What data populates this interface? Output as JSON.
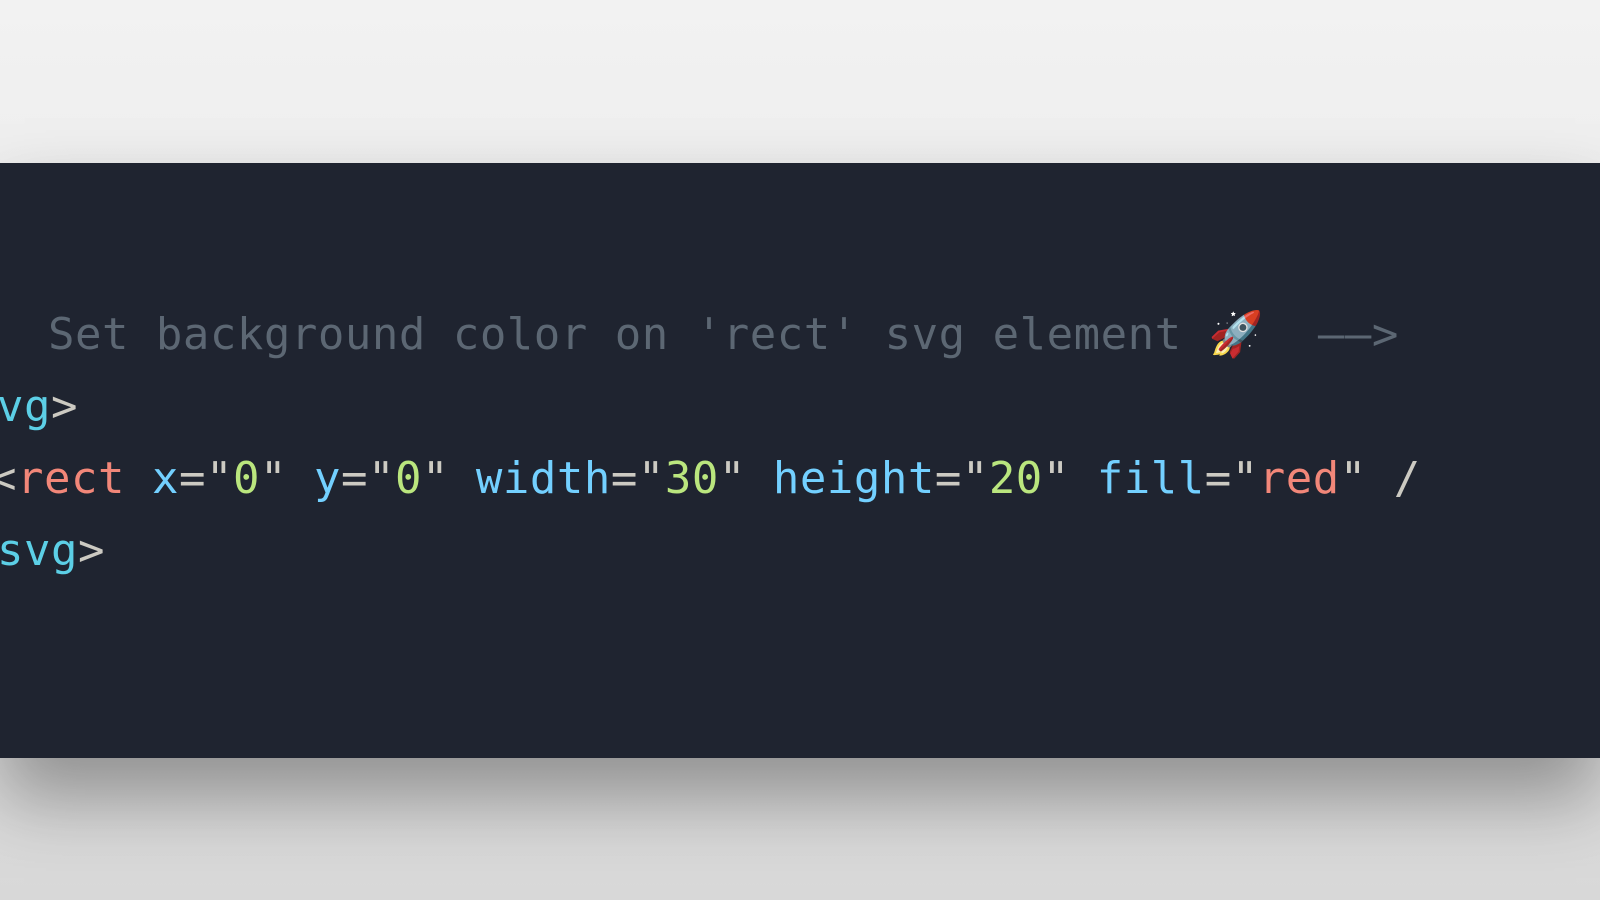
{
  "code": {
    "comment_open_dashes": "—— ",
    "comment_text": " Set background color on 'rect' svg element ",
    "comment_emoji": "🚀",
    "comment_close_arrow": "  ——>",
    "open_svg_text": "svg",
    "open_svg_brkt": ">",
    "rect_open": "<",
    "rect_tag": "rect",
    "attr_x": " x",
    "eq1": "=",
    "val_x_q": "\"",
    "val_x": "0",
    "attr_y": " y",
    "eq2": "=",
    "val_y": "0",
    "attr_width": " width",
    "eq3": "=",
    "val_width": "30",
    "attr_height": " height",
    "eq4": "=",
    "val_height": "20",
    "attr_fill": " fill",
    "eq5": "=",
    "val_fill": "red",
    "val_q": "\"",
    "rect_trailing": " /",
    "close_svg_slash": "/",
    "close_svg_text": "svg",
    "close_svg_brkt": ">"
  }
}
